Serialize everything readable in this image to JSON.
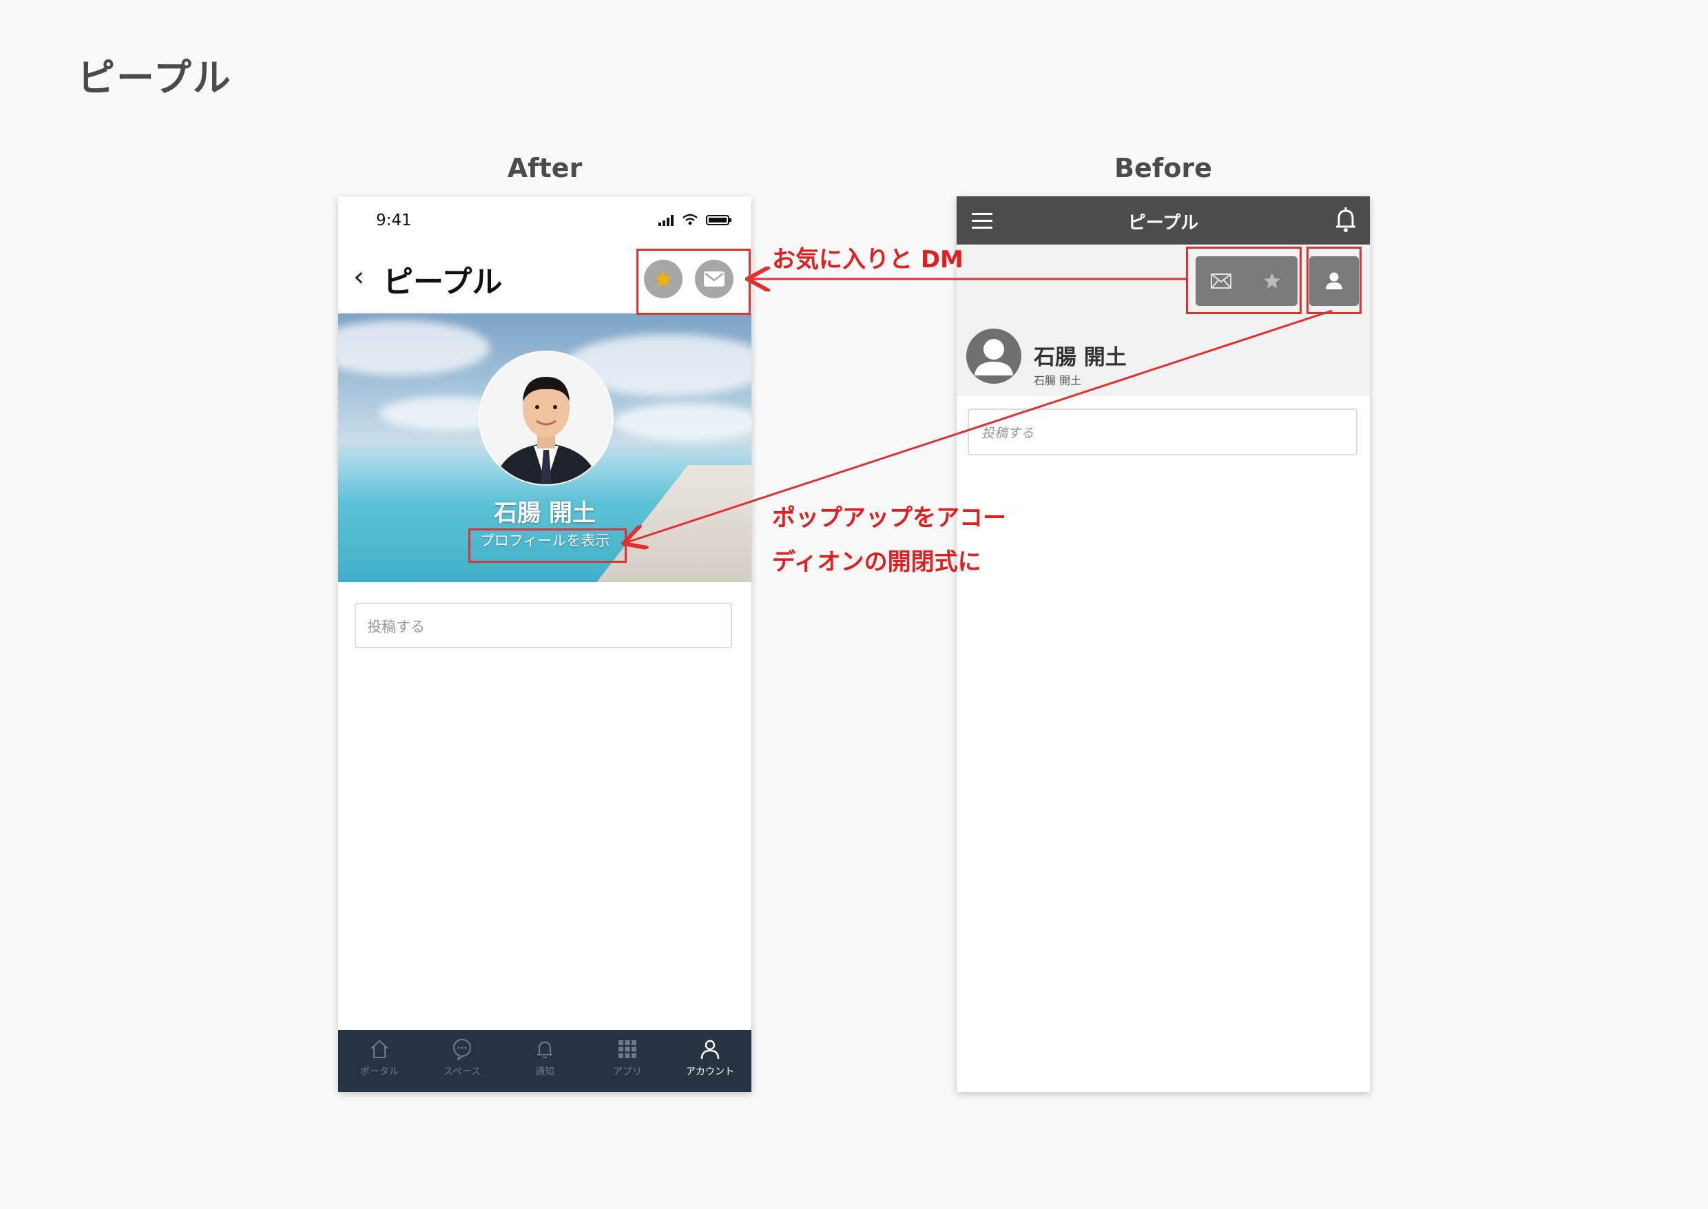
{
  "page": {
    "title": "ピープル"
  },
  "columns": {
    "after": "After",
    "before": "Before"
  },
  "after": {
    "status_time": "9:41",
    "nav_back_glyph": "‹",
    "nav_title": "ピープル",
    "profile_name": "石腸 開土",
    "profile_link": "プロフィールを表示",
    "post_placeholder": "投稿する",
    "tabs": [
      {
        "label": "ポータル",
        "icon": "home-icon",
        "active": false
      },
      {
        "label": "スペース",
        "icon": "chat-bubble-icon",
        "active": false
      },
      {
        "label": "通知",
        "icon": "bell-icon",
        "active": false
      },
      {
        "label": "アプリ",
        "icon": "grid-icon",
        "active": false
      },
      {
        "label": "アカウント",
        "icon": "person-icon",
        "active": true
      }
    ]
  },
  "before": {
    "header_title": "ピープル",
    "profile_name": "石腸 開土",
    "profile_sub": "石腸 開土",
    "post_placeholder": "投稿する"
  },
  "annotations": {
    "fav_dm": "お気に入りと DM",
    "popup_line1": "ポップアップをアコー",
    "popup_line2": "ディオンの開閉式に"
  },
  "colors": {
    "annotation_red": "#e23030",
    "star_gold": "#f0b400",
    "tabbar_bg": "#263341",
    "before_header_bg": "#4c4c4c"
  }
}
